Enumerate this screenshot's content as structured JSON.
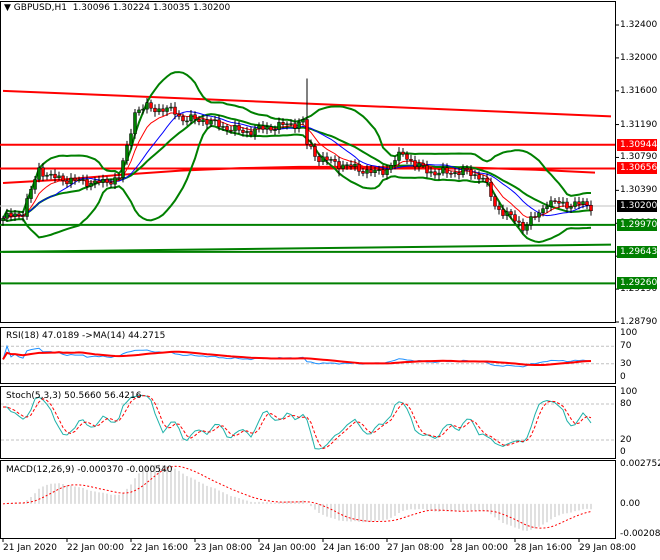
{
  "header": {
    "symbol": "GBPUSD,H1",
    "open": "1.30096",
    "high": "1.30224",
    "low": "1.30035",
    "close": "1.30200"
  },
  "colors": {
    "bull": "#008000",
    "bear": "#ff0000",
    "support": "#008000",
    "resistance": "#ff0000",
    "current": "#000000",
    "ma_fast": "#ff0000",
    "ma_slow": "#0000ff",
    "bollinger": "#008000"
  },
  "chart_data": {
    "type": "candlestick",
    "title": "GBPUSD,H1",
    "ylim": [
      1.2879,
      1.3261
    ],
    "bars": 148,
    "close_keypoints": [
      [
        0,
        1.3005
      ],
      [
        5,
        1.3012
      ],
      [
        9,
        1.3065
      ],
      [
        12,
        1.3055
      ],
      [
        19,
        1.305
      ],
      [
        25,
        1.3048
      ],
      [
        29,
        1.3055
      ],
      [
        31,
        1.309
      ],
      [
        33,
        1.3135
      ],
      [
        36,
        1.314
      ],
      [
        43,
        1.3135
      ],
      [
        45,
        1.3125
      ],
      [
        50,
        1.3125
      ],
      [
        56,
        1.3115
      ],
      [
        60,
        1.311
      ],
      [
        70,
        1.3118
      ],
      [
        75,
        1.3122
      ],
      [
        76,
        1.3095
      ],
      [
        79,
        1.3078
      ],
      [
        85,
        1.307
      ],
      [
        93,
        1.306
      ],
      [
        96,
        1.3065
      ],
      [
        100,
        1.3085
      ],
      [
        103,
        1.307
      ],
      [
        108,
        1.306
      ],
      [
        115,
        1.3062
      ],
      [
        120,
        1.3055
      ],
      [
        123,
        1.302
      ],
      [
        126,
        1.301
      ],
      [
        130,
        1.2995
      ],
      [
        134,
        1.301
      ],
      [
        136,
        1.3025
      ],
      [
        140,
        1.3022
      ],
      [
        145,
        1.3022
      ],
      [
        147,
        1.302
      ]
    ],
    "price_ticks": [
      "1.32400",
      "1.32000",
      "1.31600",
      "1.31190",
      "1.30790",
      "1.30390",
      "1.29990",
      "1.29590",
      "1.29190",
      "1.28790"
    ],
    "price_tick_values": [
      1.324,
      1.32,
      1.316,
      1.3119,
      1.3079,
      1.3039,
      1.2999,
      1.2959,
      1.2919,
      1.2879
    ],
    "levels": [
      {
        "label": "1.30944",
        "value": 1.30944,
        "kind": "resistance"
      },
      {
        "label": "1.30656",
        "value": 1.30656,
        "kind": "resistance"
      },
      {
        "label": "1.30200",
        "value": 1.302,
        "kind": "current"
      },
      {
        "label": "1.29970",
        "value": 1.2997,
        "kind": "support"
      },
      {
        "label": "1.29643",
        "value": 1.29643,
        "kind": "support"
      },
      {
        "label": "1.29260",
        "value": 1.2926,
        "kind": "support"
      }
    ],
    "trendlines": [
      {
        "kind": "resistance",
        "from": [
          0,
          1.316
        ],
        "to": [
          152,
          1.3129
        ]
      },
      {
        "kind": "support",
        "from": [
          0,
          1.29643
        ],
        "to": [
          152,
          1.2973
        ]
      }
    ],
    "time_labels": [
      "21 Jan 2020",
      "22 Jan 00:00",
      "22 Jan 16:00",
      "23 Jan 08:00",
      "24 Jan 00:00",
      "24 Jan 16:00",
      "27 Jan 08:00",
      "28 Jan 00:00",
      "28 Jan 16:00",
      "29 Jan 08:00"
    ],
    "time_label_bars": [
      0,
      16,
      32,
      48,
      64,
      80,
      96,
      112,
      128,
      144
    ],
    "rsi": {
      "title": "RSI(18) 47.0189  ->MA(14) 44.2715",
      "ticks": [
        "100",
        "70",
        "30",
        "0"
      ],
      "tick_values": [
        100,
        70,
        30,
        0
      ],
      "ylim": [
        0,
        100
      ]
    },
    "stoch": {
      "title": "Stoch(5,3,3) 50.5660 56.4216",
      "ticks": [
        "100",
        "80",
        "20",
        "0"
      ],
      "tick_values": [
        100,
        80,
        20,
        0
      ],
      "ylim": [
        0,
        100
      ]
    },
    "macd": {
      "title": "MACD(12,26,9) -0.000370 -0.000540",
      "ticks": [
        "0.002752",
        "0.00",
        "-0.00208"
      ],
      "tick_values": [
        0.002752,
        0,
        -0.00208
      ],
      "ylim": [
        -0.00208,
        0.002752
      ]
    }
  }
}
